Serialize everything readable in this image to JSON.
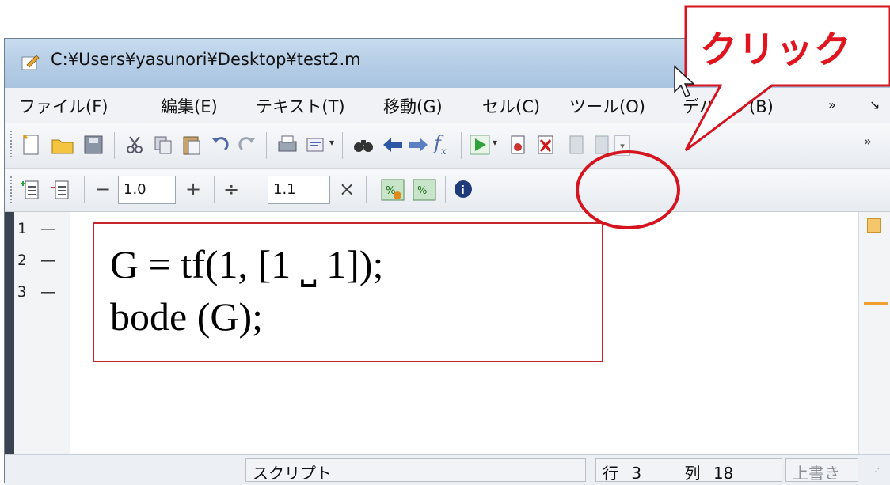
{
  "window": {
    "title": "C:¥Users¥yasunori¥Desktop¥test2.m"
  },
  "menu": [
    {
      "label": "ファイル(F)"
    },
    {
      "label": "編集(E)"
    },
    {
      "label": "テキスト(T)"
    },
    {
      "label": "移動(G)"
    },
    {
      "label": "セル(C)"
    },
    {
      "label": "ツール(O)"
    },
    {
      "label": "デバッグ(B)"
    },
    {
      "label": "»"
    }
  ],
  "toolbar2": {
    "decrement_label": "−",
    "decrement_value": "1.0",
    "increment_label": "+",
    "divide_label": "÷",
    "divide_value": "1.1",
    "multiply_label": "×"
  },
  "editor": {
    "line_numbers": [
      "1",
      "2",
      "3"
    ],
    "code_lines": [
      "G = tf(1, [1 ⎵ 1]);",
      "bode (G);"
    ]
  },
  "status": {
    "mode": "スクリプト",
    "row_label": "行",
    "row_value": "3",
    "col_label": "列",
    "col_value": "18",
    "overwrite": "上書き"
  },
  "callout": {
    "text": "クリック",
    "color": "#e0151f"
  },
  "icons": [
    "new-file-icon",
    "open-folder-icon",
    "save-icon",
    "cut-icon",
    "copy-icon",
    "paste-icon",
    "undo-icon",
    "redo-icon",
    "print-icon",
    "preview-icon",
    "find-icon",
    "back-icon",
    "forward-icon",
    "function-icon",
    "run-icon",
    "cell-icon",
    "close-cell-icon",
    "cell-prev-icon",
    "cell-next-icon",
    "dropdown-icon",
    "insert-cell-icon",
    "remove-cell-icon",
    "percent-add-icon",
    "percent-remove-icon",
    "info-icon"
  ]
}
